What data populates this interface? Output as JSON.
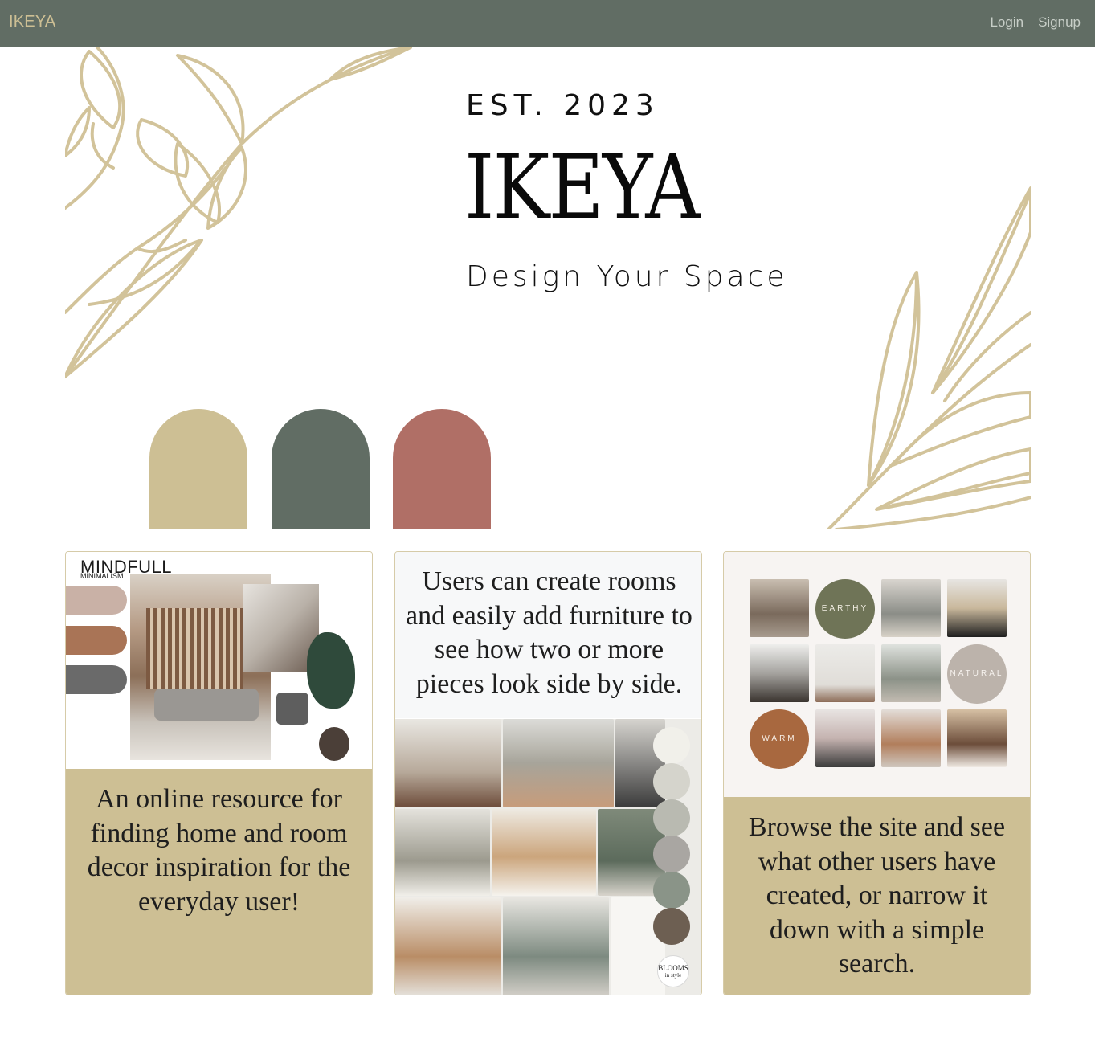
{
  "navbar": {
    "brand": "IKEYA",
    "links": [
      "Login",
      "Signup"
    ]
  },
  "hero": {
    "est": "EST. 2023",
    "title": "IKEYA",
    "tagline": "Design Your Space",
    "arch_colors": [
      "#cdbf94",
      "#616d64",
      "#b06f66"
    ]
  },
  "cards": [
    {
      "image_heading": "MINDFULL",
      "image_subheading": "MINIMALISM",
      "text": "An online resource for finding home and room decor inspiration for the everyday user!"
    },
    {
      "text": "Users can create rooms and easily add furniture to see how two or more pieces look side by side.",
      "image_sign": "BLOOMS",
      "image_sign_sub": "in style",
      "palette": [
        "#f1f0ea",
        "#d5d4cc",
        "#b9bab1",
        "#a9a6a2",
        "#8a9488",
        "#6d5f52"
      ]
    },
    {
      "badges": [
        "EARTHY",
        "NATURAL",
        "WARM"
      ],
      "text": "Browse the site and see what other users have created, or narrow it down with a simple search."
    }
  ],
  "colors": {
    "sage": "#616d64",
    "sand": "#cdbf94",
    "clay": "#b06f66"
  }
}
